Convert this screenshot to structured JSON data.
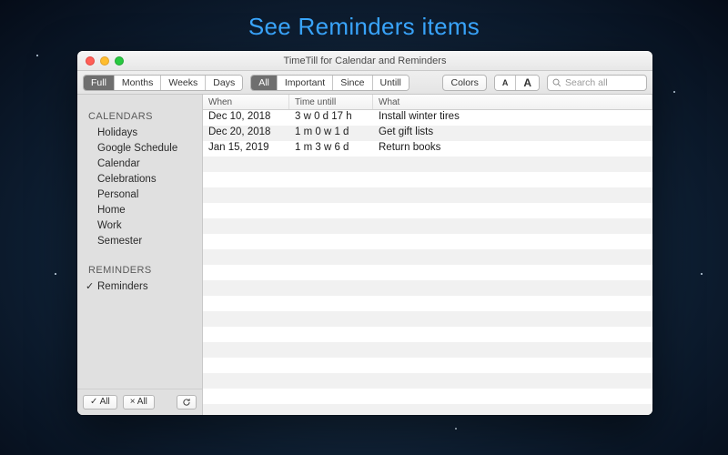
{
  "headline": "See Reminders items",
  "window": {
    "title": "TimeTill for Calendar and Reminders"
  },
  "toolbar": {
    "view_segment": [
      "Full",
      "Months",
      "Weeks",
      "Days"
    ],
    "view_active": 0,
    "filter_segment": [
      "All",
      "Important",
      "Since",
      "Untill"
    ],
    "filter_active": 0,
    "colors_button": "Colors",
    "font_small": "A",
    "font_large": "A",
    "search_placeholder": "Search all"
  },
  "sidebar": {
    "calendars_header": "CALENDARS",
    "calendars": [
      "Holidays",
      "Google Schedule",
      "Calendar",
      "Celebrations",
      "Personal",
      "Home",
      "Work",
      "Semester"
    ],
    "reminders_header": "REMINDERS",
    "reminders": [
      {
        "label": "Reminders",
        "checked": true
      }
    ],
    "check_all": "✓ All",
    "uncheck_all": "× All"
  },
  "table": {
    "columns": {
      "when": "When",
      "until": "Time untill",
      "what": "What"
    },
    "rows": [
      {
        "when": "Dec 10, 2018",
        "until": "3 w 0 d 17 h",
        "what": "Install winter tires"
      },
      {
        "when": "Dec 20, 2018",
        "until": "1 m 0 w 1 d",
        "what": "Get gift lists"
      },
      {
        "when": "Jan 15, 2019",
        "until": "1 m 3 w 6 d",
        "what": "Return books"
      }
    ],
    "blank_rows": 17
  }
}
